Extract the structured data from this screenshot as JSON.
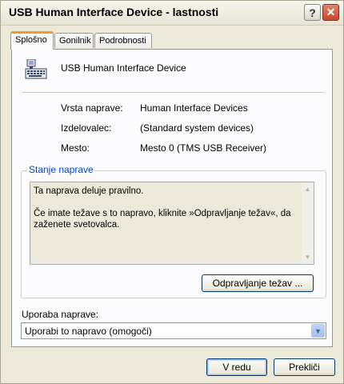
{
  "window": {
    "title": "USB Human Interface Device - lastnosti"
  },
  "tabs": [
    {
      "label": "Splošno",
      "active": true
    },
    {
      "label": "Gonilnik",
      "active": false
    },
    {
      "label": "Podrobnosti",
      "active": false
    }
  ],
  "device": {
    "name": "USB Human Interface Device",
    "icon": "usb-device-icon",
    "properties": [
      {
        "label": "Vrsta naprave:",
        "value": "Human Interface Devices"
      },
      {
        "label": "Izdelovalec:",
        "value": "(Standard system devices)"
      },
      {
        "label": "Mesto:",
        "value": "Mesto 0 (TMS USB Receiver)"
      }
    ]
  },
  "status": {
    "title": "Stanje naprave",
    "text": "Ta naprava deluje pravilno.\n\nČe imate težave s to napravo, kliknite »Odpravljanje težav«, da zaženete svetovalca.",
    "troubleshoot_button": "Odpravljanje težav ..."
  },
  "usage": {
    "label": "Uporaba naprave:",
    "selected": "Uporabi to napravo (omogoči)"
  },
  "buttons": {
    "ok": "V redu",
    "cancel": "Prekliči"
  },
  "colors": {
    "tab_highlight": "#e79e2b",
    "group_title": "#0046d5",
    "close_button": "#c7462b"
  }
}
